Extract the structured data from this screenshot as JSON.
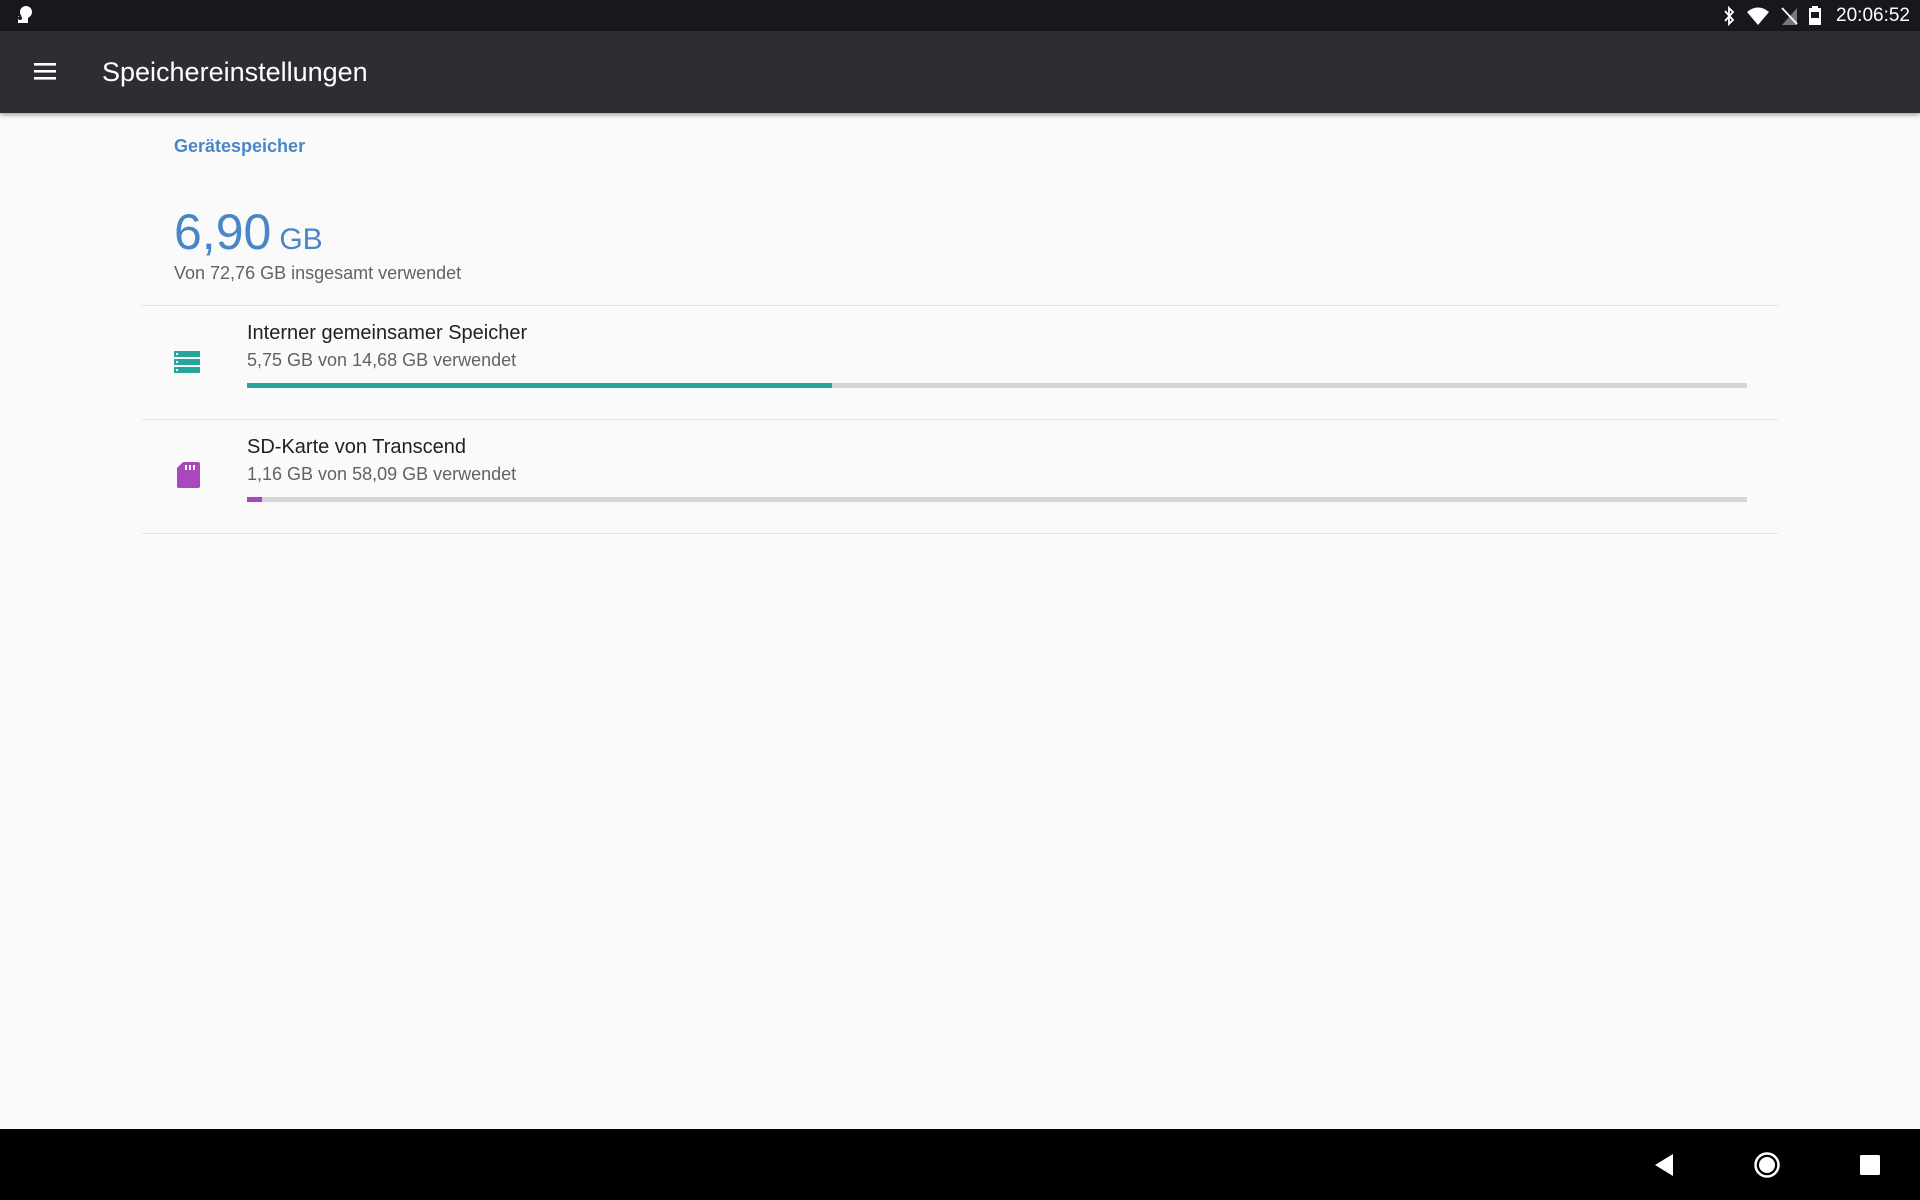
{
  "status_bar": {
    "time": "20:06:52",
    "icons": [
      "notification-icon",
      "bluetooth-icon",
      "wifi-icon",
      "no-sim-icon",
      "battery-icon"
    ]
  },
  "app_bar": {
    "title": "Speichereinstellungen",
    "menu_icon": "hamburger-menu-icon"
  },
  "storage": {
    "section_header": "Gerätespeicher",
    "total_used_value": "6,90",
    "total_used_unit": "GB",
    "total_summary": "Von 72,76 GB insgesamt verwendet",
    "volumes": [
      {
        "title": "Interner gemeinsamer Speicher",
        "subtitle": "5,75 GB von 14,68 GB verwendet",
        "used_fraction": 0.39,
        "color": "#26a69a",
        "icon": "internal-storage-icon"
      },
      {
        "title": "SD-Karte von Transcend",
        "subtitle": "1,16 GB von 58,09 GB verwendet",
        "used_fraction": 0.01,
        "color": "#ab47bc",
        "icon": "sd-card-icon"
      }
    ]
  },
  "nav_bar": {
    "buttons": [
      "back-icon",
      "home-icon",
      "recents-icon"
    ]
  }
}
